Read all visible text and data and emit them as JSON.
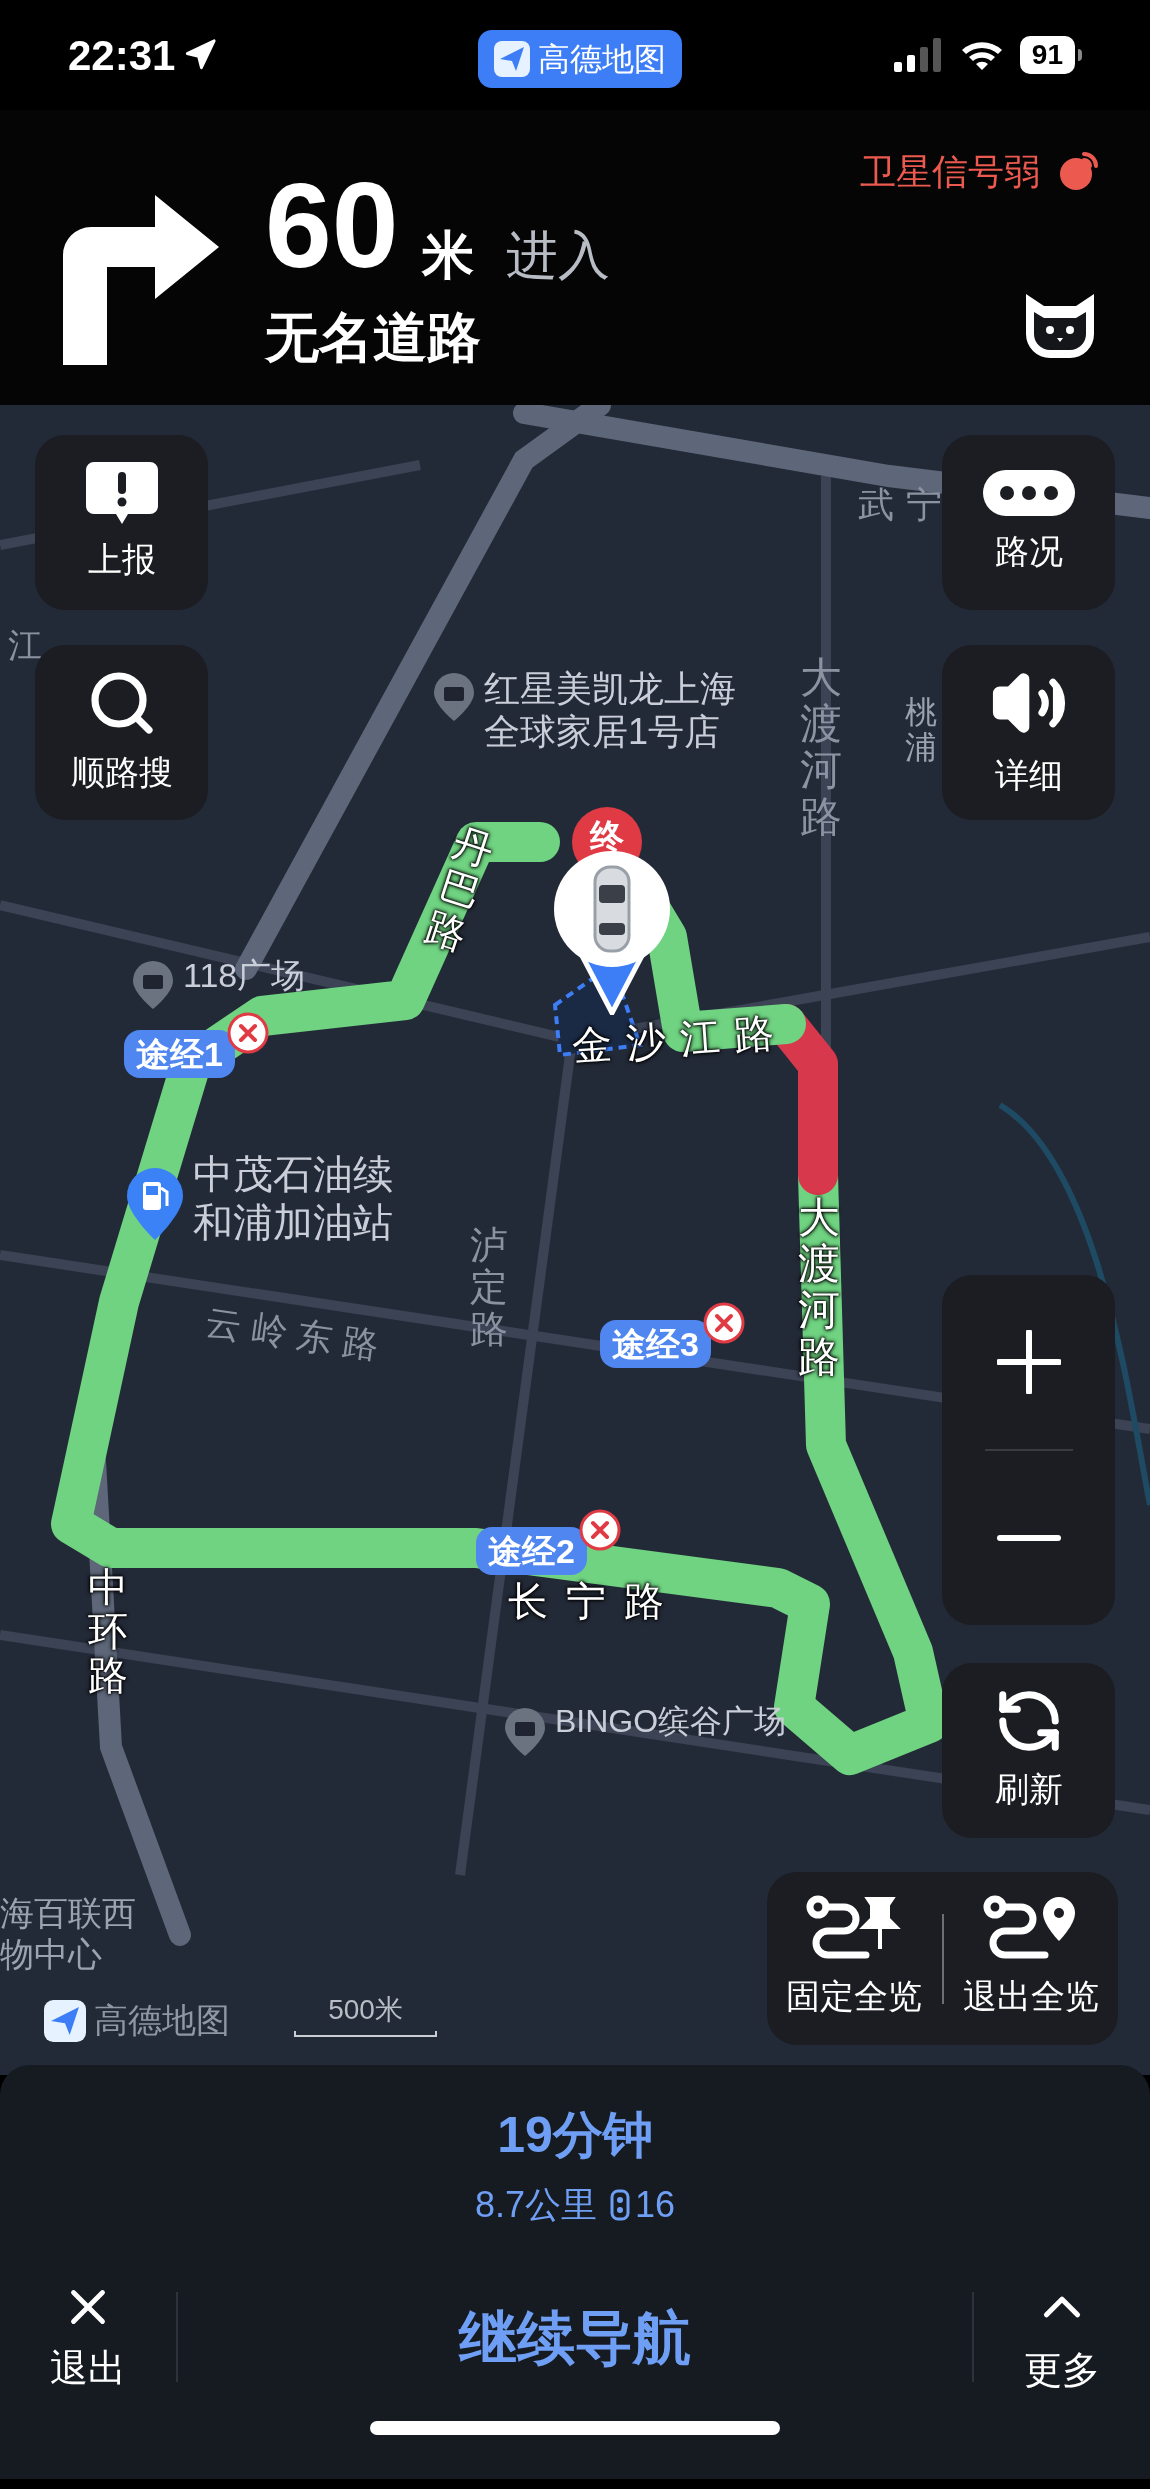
{
  "status_bar": {
    "time": "22:31",
    "app_badge": "高德地图",
    "battery": "91"
  },
  "guidance": {
    "distance": "60",
    "unit": "米",
    "action": "进入",
    "road": "无名道路",
    "gps_warning": "卫星信号弱"
  },
  "map": {
    "labels": [
      {
        "kind": "road",
        "lines": [
          "武宁"
        ]
      },
      {
        "kind": "road",
        "lines": [
          "江"
        ]
      },
      {
        "kind": "poi",
        "lines": [
          "红星美凯龙上海",
          "全球家居1号店"
        ]
      },
      {
        "kind": "place",
        "lines": [
          "桃浦"
        ]
      },
      {
        "kind": "road",
        "lines": [
          "大渡河路"
        ]
      },
      {
        "kind": "route_road",
        "lines": [
          "丹巴路"
        ]
      },
      {
        "kind": "poi",
        "lines": [
          "118广场"
        ]
      },
      {
        "kind": "route_road",
        "lines": [
          "金沙江路"
        ]
      },
      {
        "kind": "fuel",
        "lines": [
          "中茂石油续",
          "和浦加油站"
        ]
      },
      {
        "kind": "road",
        "lines": [
          "泸定路"
        ]
      },
      {
        "kind": "road",
        "lines": [
          "云岭东路"
        ]
      },
      {
        "kind": "route_road",
        "lines": [
          "大渡河路"
        ]
      },
      {
        "kind": "route_road",
        "lines": [
          "中环路"
        ]
      },
      {
        "kind": "route_road",
        "lines": [
          "长宁路"
        ]
      },
      {
        "kind": "poi",
        "lines": [
          "BINGO缤谷广场"
        ]
      },
      {
        "kind": "place",
        "lines": [
          "海百联西",
          "物中心"
        ]
      }
    ],
    "route_segments": [
      {
        "color": "#6fd381"
      },
      {
        "color": "#d8384c"
      },
      {
        "color": "#6fd381"
      }
    ],
    "end_marker": "终",
    "waypoints": [
      {
        "label": "途经1"
      },
      {
        "label": "途经3"
      },
      {
        "label": "途经2"
      }
    ],
    "logo": "高德地图",
    "scale": "500米"
  },
  "left_buttons": [
    {
      "kind": "report",
      "label": "上报"
    },
    {
      "kind": "search",
      "label": "顺路搜"
    }
  ],
  "right_buttons": [
    {
      "kind": "traffic",
      "label": "路况"
    },
    {
      "kind": "voice",
      "label": "详细"
    }
  ],
  "refresh_button": {
    "label": "刷新"
  },
  "overview_buttons": [
    {
      "kind": "pin",
      "label": "固定全览"
    },
    {
      "kind": "exit",
      "label": "退出全览"
    }
  ],
  "summary": {
    "time": "19分钟",
    "distance": "8.7公里",
    "lights": "16"
  },
  "actions": {
    "exit": "退出",
    "main": "继续导航",
    "more": "更多"
  }
}
